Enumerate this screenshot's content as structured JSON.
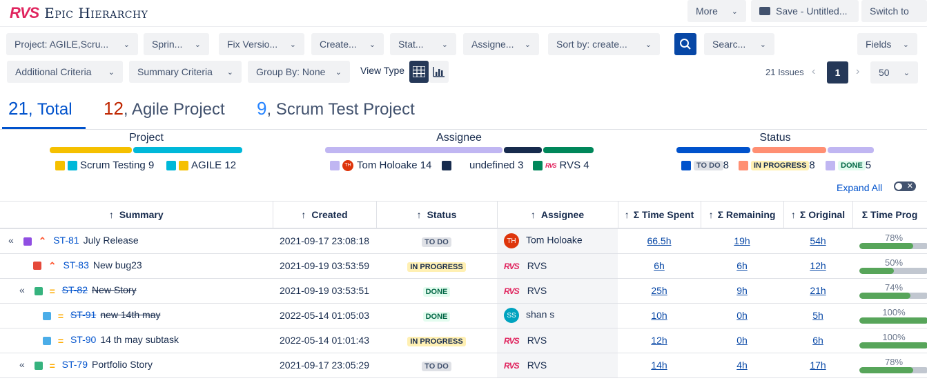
{
  "brand": {
    "logo": "RVS",
    "title": "Epic Hierarchy"
  },
  "header": {
    "more": "More",
    "save": "Save - Untitled...",
    "switch": "Switch to"
  },
  "filters": {
    "project": "Project: AGILE,Scru...",
    "sprint": "Sprin...",
    "fix_version": "Fix Versio...",
    "created": "Create...",
    "status": "Stat...",
    "assignee": "Assigne...",
    "sort": "Sort by: create...",
    "search": "Searc...",
    "fields": "Fields",
    "additional": "Additional Criteria",
    "summary": "Summary Criteria",
    "group_by": "Group By: None",
    "view_type": "View Type"
  },
  "pagination": {
    "issues": "21 Issues",
    "page": "1",
    "per_page": "50"
  },
  "tabs": [
    {
      "count": "21",
      "label": ", Total",
      "color": "#0052cc"
    },
    {
      "count": "12",
      "label": ", Agile Project",
      "color": "#bf2600"
    },
    {
      "count": "9",
      "label": ", Scrum Test Project",
      "color": "#2684ff"
    }
  ],
  "legends": {
    "project": {
      "title": "Project",
      "items": [
        {
          "label": "Scrum Testing",
          "count": "9",
          "color": "#f5c000"
        },
        {
          "label": "AGILE",
          "count": "12",
          "color": "#00b8d9"
        }
      ]
    },
    "assignee": {
      "title": "Assignee",
      "items": [
        {
          "label": "Tom Holoake",
          "count": "14",
          "color": "#c0b6f2"
        },
        {
          "label": "undefined",
          "count": "3",
          "color": "#172b4d"
        },
        {
          "label": "RVS",
          "count": "4",
          "color": "#00875a"
        }
      ]
    },
    "status": {
      "title": "Status",
      "items": [
        {
          "label": "TO DO",
          "count": "8",
          "color": "#0052cc"
        },
        {
          "label": "IN PROGRESS",
          "count": "8",
          "color": "#ff8f73"
        },
        {
          "label": "DONE",
          "count": "5",
          "color": "#c0b6f2"
        }
      ]
    }
  },
  "expand_all": "Expand All",
  "table": {
    "columns": [
      "Summary",
      "Created",
      "Status",
      "Assignee",
      "Σ Time Spent",
      "Σ Remaining",
      "Σ Original",
      "Σ Time Prog"
    ],
    "rows": [
      {
        "key": "ST-81",
        "summary": "July Release",
        "created": "2021-09-17 23:08:18",
        "status": "TO DO",
        "assignee": "Tom Holoake",
        "avatar": "TH",
        "spent": "66.5h",
        "remaining": "19h",
        "original": "54h",
        "progress": "78%"
      },
      {
        "key": "ST-83",
        "summary": "New bug23",
        "created": "2021-09-19 03:53:59",
        "status": "IN PROGRESS",
        "assignee": "RVS",
        "avatar": "RVS",
        "spent": "6h",
        "remaining": "6h",
        "original": "12h",
        "progress": "50%"
      },
      {
        "key": "ST-82",
        "summary": "New Story",
        "created": "2021-09-19 03:53:51",
        "status": "DONE",
        "assignee": "RVS",
        "avatar": "RVS",
        "spent": "25h",
        "remaining": "9h",
        "original": "21h",
        "progress": "74%"
      },
      {
        "key": "ST-91",
        "summary": "new 14th may",
        "created": "2022-05-14 01:05:03",
        "status": "DONE",
        "assignee": "shan s",
        "avatar": "SS",
        "spent": "10h",
        "remaining": "0h",
        "original": "5h",
        "progress": "100%"
      },
      {
        "key": "ST-90",
        "summary": "14 th may subtask",
        "created": "2022-05-14 01:01:43",
        "status": "IN PROGRESS",
        "assignee": "RVS",
        "avatar": "RVS",
        "spent": "12h",
        "remaining": "0h",
        "original": "6h",
        "progress": "100%"
      },
      {
        "key": "ST-79",
        "summary": "Portfolio Story",
        "created": "2021-09-17 23:05:29",
        "status": "TO DO",
        "assignee": "RVS",
        "avatar": "RVS",
        "spent": "14h",
        "remaining": "4h",
        "original": "17h",
        "progress": "78%"
      }
    ]
  }
}
